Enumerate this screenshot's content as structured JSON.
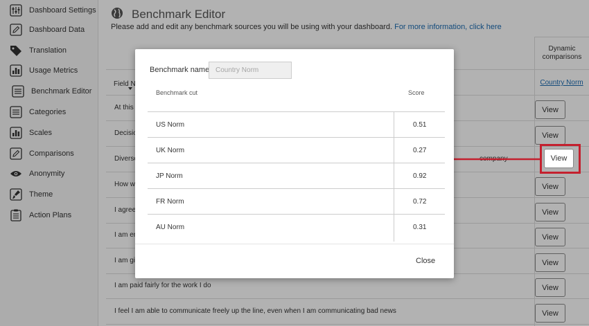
{
  "sidebar": {
    "items": [
      {
        "label": "Dashboard Settings",
        "icon": "sliders-icon"
      },
      {
        "label": "Dashboard Data",
        "icon": "pencil-icon"
      },
      {
        "label": "Translation",
        "icon": "tag-icon"
      },
      {
        "label": "Usage Metrics",
        "icon": "bar-chart-icon"
      },
      {
        "label": "Benchmark Editor",
        "icon": "list-icon"
      },
      {
        "label": "Categories",
        "icon": "list-icon"
      },
      {
        "label": "Scales",
        "icon": "bar-chart-icon"
      },
      {
        "label": "Comparisons",
        "icon": "pencil-icon"
      },
      {
        "label": "Anonymity",
        "icon": "eye-icon"
      },
      {
        "label": "Theme",
        "icon": "brush-icon"
      },
      {
        "label": "Action Plans",
        "icon": "clipboard-icon"
      }
    ]
  },
  "header": {
    "title": "Benchmark Editor",
    "subtitle": "Please add and edit any benchmark sources you will be using with your dashboard.",
    "link": "For more information, click here"
  },
  "table": {
    "field_name_header": "Field N",
    "dynamic_header": "Dynamic comparisons",
    "dynamic_link": "Country Norm",
    "view_label": "View",
    "rows": [
      "At this c",
      "Decisio",
      "Diverse",
      "How w",
      "I agree",
      "I am en",
      "I am giv",
      "I am paid fairly for the work I do",
      "I feel I am able to communicate freely up the line, even when I am communicating bad news"
    ],
    "row3_fragment": "company"
  },
  "modal": {
    "name_label": "Benchmark name",
    "name_placeholder": "Country Norm",
    "col_cut": "Benchmark cut",
    "col_score": "Score",
    "rows": [
      {
        "cut": "US Norm",
        "score": "0.51"
      },
      {
        "cut": "UK Norm",
        "score": "0.27"
      },
      {
        "cut": "JP Norm",
        "score": "0.92"
      },
      {
        "cut": "FR Norm",
        "score": "0.72"
      },
      {
        "cut": "AU Norm",
        "score": "0.31"
      }
    ],
    "close_label": "Close"
  },
  "colors": {
    "link": "#1b6bb1",
    "highlight": "#c4202e"
  }
}
